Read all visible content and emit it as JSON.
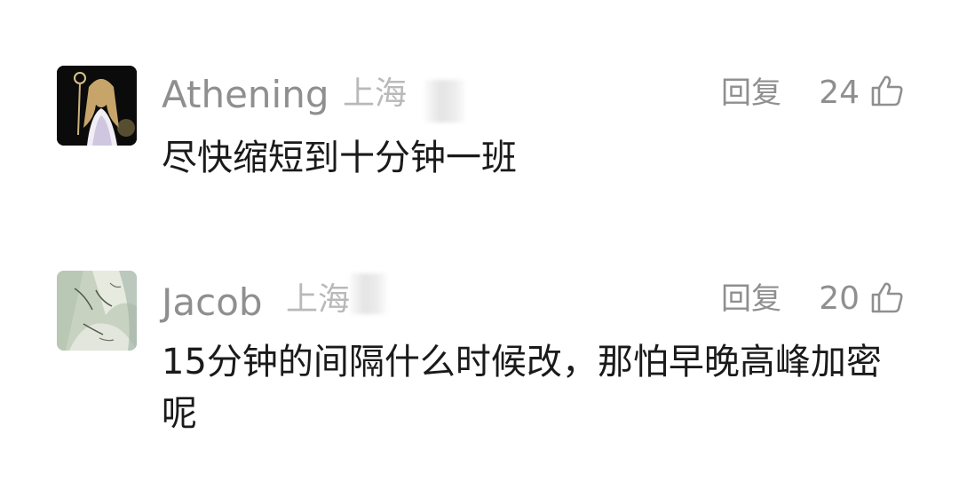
{
  "comments": [
    {
      "username": "Athening",
      "location": "上海",
      "reply_label": "回复",
      "likes": "24",
      "text": "尽快缩短到十分钟一班",
      "avatar_icon": "anime-character-avatar"
    },
    {
      "username": "Jacob",
      "location": "上海",
      "reply_label": "回复",
      "likes": "20",
      "text": "15分钟的间隔什么时候改，那怕早晚高峰加密呢",
      "avatar_icon": "landscape-sketch-avatar"
    }
  ],
  "colors": {
    "meta": "#8f8f8f",
    "location": "#b9b9b9",
    "content": "#1a1a1a"
  }
}
